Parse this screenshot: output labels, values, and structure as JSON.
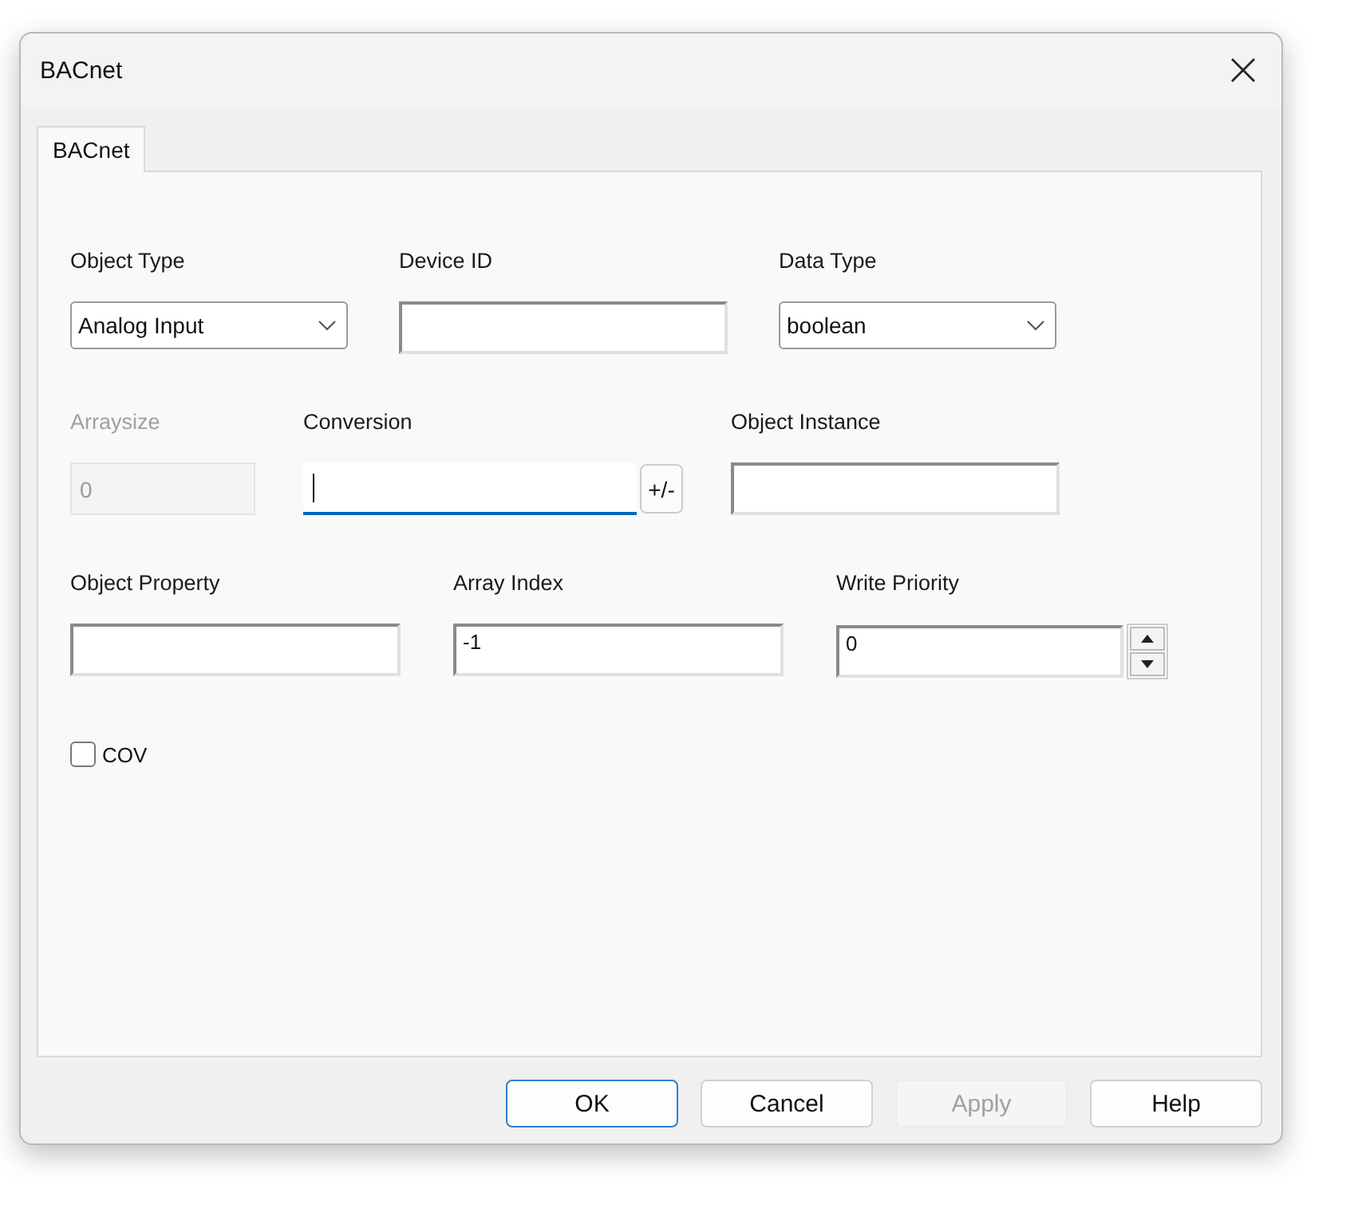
{
  "window": {
    "title": "BACnet"
  },
  "tabs": [
    {
      "label": "BACnet",
      "selected": true
    }
  ],
  "rows": [
    [
      {
        "kind": "combo",
        "label": "Object Type",
        "value": "Analog Input",
        "disabled": false,
        "focused": false
      },
      {
        "kind": "text",
        "label": "Device ID",
        "disabled": false,
        "focused": false
      },
      {
        "kind": "combo",
        "label": "Data Type",
        "value": "boolean",
        "disabled": false,
        "focused": false
      }
    ],
    [
      {
        "kind": "text",
        "label": "Arraysize",
        "value": "0",
        "disabled": true,
        "focused": false
      },
      {
        "kind": "sign",
        "label": "Conversion",
        "button": "+/-",
        "disabled": false,
        "focused": true
      },
      {
        "kind": "text",
        "label": "Object Instance",
        "disabled": false,
        "focused": false
      }
    ],
    [
      {
        "kind": "text",
        "label": "Object Property",
        "disabled": false,
        "focused": false
      },
      {
        "kind": "text",
        "label": "Array Index",
        "value": "-1",
        "disabled": false,
        "focused": false
      },
      {
        "kind": "spin",
        "label": "Write Priority",
        "value": "0",
        "disabled": false,
        "focused": false
      }
    ]
  ],
  "cov": {
    "label": "COV",
    "checked": false
  },
  "buttons": [
    {
      "label": "OK",
      "default": true,
      "disabled": false
    },
    {
      "label": "Cancel",
      "default": false,
      "disabled": false
    },
    {
      "label": "Apply",
      "default": false,
      "disabled": true
    },
    {
      "label": "Help",
      "default": false,
      "disabled": false
    }
  ]
}
